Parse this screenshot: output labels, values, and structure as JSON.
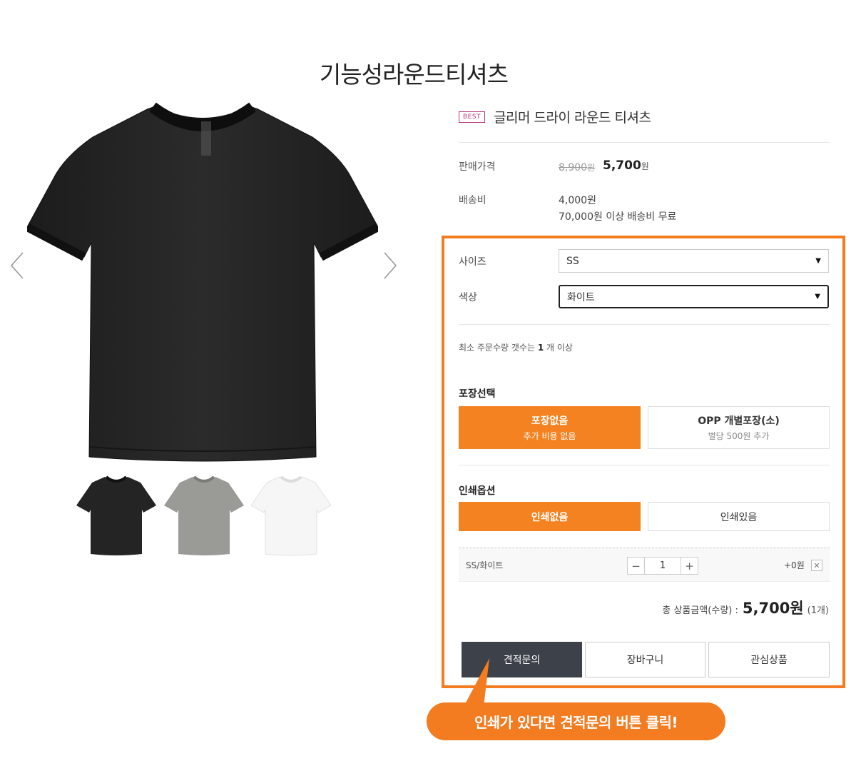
{
  "page_title": "기능성라운드티셔츠",
  "product": {
    "badge": "BEST",
    "name": "글리머 드라이 라운드 티셔츠"
  },
  "price": {
    "label": "판매가격",
    "original": "8,900",
    "sale": "5,700",
    "currency": "원"
  },
  "shipping": {
    "label": "배송비",
    "fee": "4,000원",
    "free_notice": "70,000원 이상 배송비 무료"
  },
  "options": {
    "size": {
      "label": "사이즈",
      "value": "SS"
    },
    "color": {
      "label": "색상",
      "value": "화이트"
    },
    "min_order_prefix": "최소 주문수량 갯수는 ",
    "min_order_qty": "1",
    "min_order_suffix": " 개 이상"
  },
  "packaging": {
    "title": "포장선택",
    "choices": [
      {
        "main": "포장없음",
        "sub": "추가 비용 없음",
        "active": true
      },
      {
        "main": "OPP 개별포장(소)",
        "sub": "벌당 500원 추가",
        "active": false
      }
    ]
  },
  "printing": {
    "title": "인쇄옵션",
    "choices": [
      {
        "main": "인쇄없음",
        "active": true
      },
      {
        "main": "인쇄있음",
        "active": false
      }
    ]
  },
  "selected_item": {
    "name": "SS/화이트",
    "quantity": "1",
    "minus": "−",
    "plus": "+",
    "price": "+0원",
    "remove": "✕"
  },
  "total": {
    "label": "총 상품금액(수량) :",
    "amount": "5,700원",
    "qty": "(1개)"
  },
  "actions": {
    "quote": "견적문의",
    "cart": "장바구니",
    "wishlist": "관심상품"
  },
  "callout": "인쇄가 있다면 견적문의 버튼 클릭!",
  "icons": {
    "prev": "chevron-left-icon",
    "next": "chevron-right-icon",
    "caret": "caret-down-icon"
  },
  "colors": {
    "accent": "#f37b20",
    "active_choice": "#f58220",
    "dark_button": "#3d4149",
    "badge": "#b5377a",
    "shirt_black": "#242424",
    "shirt_gray": "#9a9b97",
    "shirt_white": "#f6f6f6"
  }
}
